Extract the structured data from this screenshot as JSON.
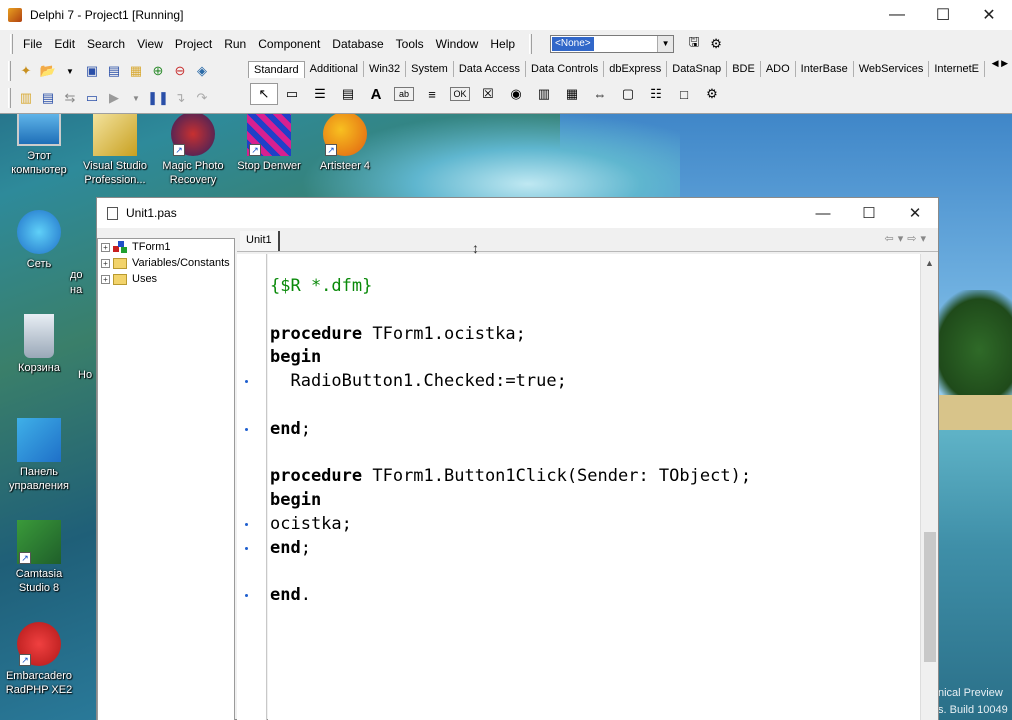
{
  "ide": {
    "title": "Delphi 7 - Project1 [Running]",
    "menu": [
      "File",
      "Edit",
      "Search",
      "View",
      "Project",
      "Run",
      "Component",
      "Database",
      "Tools",
      "Window",
      "Help"
    ],
    "combo_value": "<None>",
    "palette_tabs": [
      "Standard",
      "Additional",
      "Win32",
      "System",
      "Data Access",
      "Data Controls",
      "dbExpress",
      "DataSnap",
      "BDE",
      "ADO",
      "InterBase",
      "WebServices",
      "InternetE"
    ],
    "palette_icons": [
      "pointer-icon",
      "frames-icon",
      "mainmenu-icon",
      "popupmenu-icon",
      "label-icon",
      "edit-icon",
      "memo-icon",
      "button-icon",
      "checkbox-icon",
      "radiobutton-icon",
      "listbox-icon",
      "combobox-icon",
      "scrollbar-icon",
      "groupbox-icon",
      "radiogroup-icon",
      "panel-icon",
      "actionlist-icon"
    ]
  },
  "desktop": {
    "icons": [
      {
        "label": "Этот компьютер",
        "icon": "computer-icon"
      },
      {
        "label": "Visual Studio Profession...",
        "icon": "visual-studio-icon"
      },
      {
        "label": "Magic Photo Recovery",
        "icon": "magic-photo-icon"
      },
      {
        "label": "Stop Denwer",
        "icon": "stop-denwer-icon"
      },
      {
        "label": "Artisteer 4",
        "icon": "artisteer-icon"
      },
      {
        "label": "Сеть",
        "icon": "network-icon"
      },
      {
        "label": "Корзина",
        "icon": "recycle-bin-icon"
      },
      {
        "label": "Панель управления",
        "icon": "control-panel-icon"
      },
      {
        "label": "Camtasia Studio 8",
        "icon": "camtasia-icon"
      },
      {
        "label": "Embarcadero RadPHP XE2",
        "icon": "radphp-icon"
      }
    ],
    "partial_labels": [
      "до",
      "на",
      "Но"
    ],
    "watermark": [
      "nical Preview",
      "s. Build 10049"
    ]
  },
  "editor": {
    "title": "Unit1.pas",
    "tab": "Unit1",
    "tree": [
      "TForm1",
      "Variables/Constants",
      "Uses"
    ],
    "code_lines": [
      {
        "text": "{$R *.dfm}",
        "style": "comment",
        "dot": false
      },
      {
        "text": "",
        "style": "plain",
        "dot": false
      },
      {
        "kw": "procedure",
        "text": " TForm1.ocistka;",
        "style": "mixed",
        "dot": false
      },
      {
        "kw": "begin",
        "text": "",
        "style": "mixed",
        "dot": false
      },
      {
        "text": "  RadioButton1.Checked:=true;",
        "style": "plain",
        "dot": true
      },
      {
        "text": "",
        "style": "plain",
        "dot": false
      },
      {
        "kw": "end",
        "text": ";",
        "style": "mixed",
        "dot": true
      },
      {
        "text": "",
        "style": "plain",
        "dot": false
      },
      {
        "kw": "procedure",
        "text": " TForm1.Button1Click(Sender: TObject);",
        "style": "mixed",
        "dot": false
      },
      {
        "kw": "begin",
        "text": "",
        "style": "mixed",
        "dot": false
      },
      {
        "text": "ocistka;",
        "style": "plain",
        "dot": true
      },
      {
        "kw": "end",
        "text": ";",
        "style": "mixed",
        "dot": true
      },
      {
        "text": "",
        "style": "plain",
        "dot": false
      },
      {
        "kw": "end",
        "text": ".",
        "style": "mixed",
        "dot": true
      }
    ]
  }
}
